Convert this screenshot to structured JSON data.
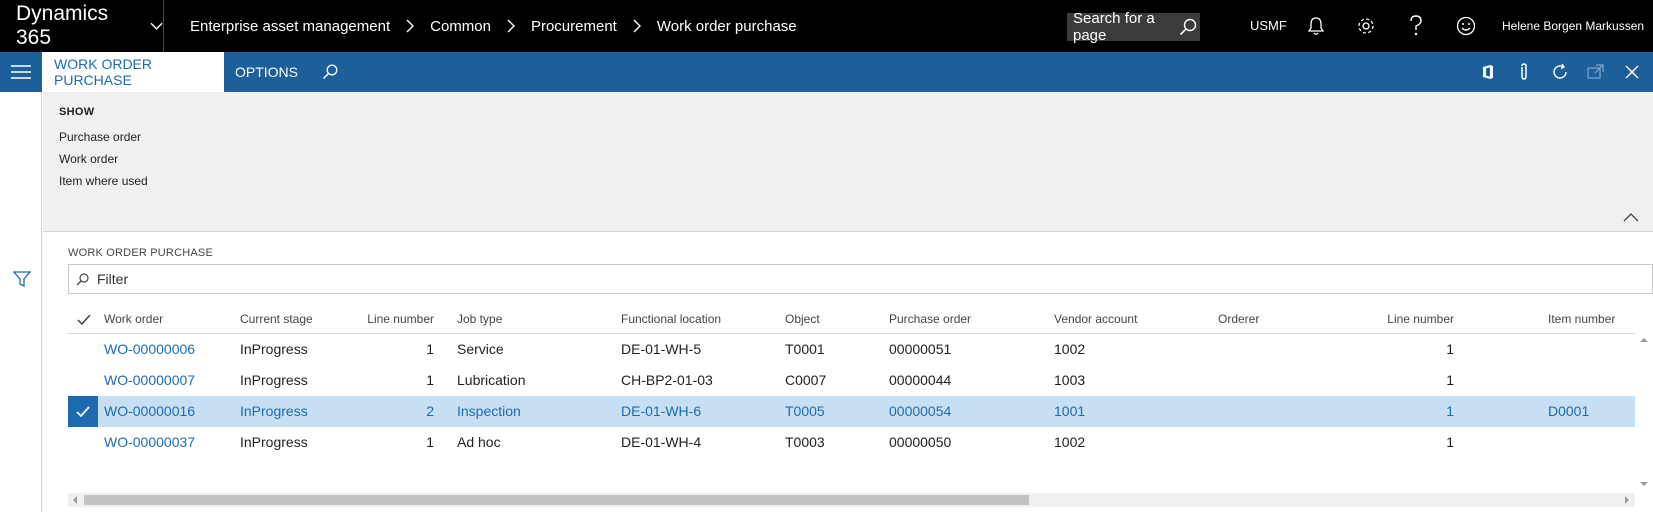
{
  "topbar": {
    "brand": "Dynamics 365",
    "breadcrumbs": [
      "Enterprise asset management",
      "Common",
      "Procurement",
      "Work order purchase"
    ],
    "search_placeholder": "Search for a page",
    "company": "USMF",
    "user": "Helene Borgen Markussen",
    "icons": [
      "chevron-down-icon",
      "search-icon",
      "bell-icon",
      "gear-icon",
      "help-icon",
      "smiley-icon"
    ]
  },
  "actionbar": {
    "active_tab": "WORK ORDER PURCHASE",
    "options_tab": "OPTIONS",
    "right_icons": [
      "office-icon",
      "attachment-icon",
      "refresh-icon",
      "open-new-window-icon",
      "close-icon"
    ]
  },
  "show_pane": {
    "title": "SHOW",
    "items": [
      "Purchase order",
      "Work order",
      "Item where used"
    ]
  },
  "grid": {
    "section_title": "WORK ORDER PURCHASE",
    "filter_placeholder": "Filter",
    "columns": {
      "work_order": "Work order",
      "current_stage": "Current stage",
      "line_number": "Line number",
      "job_type": "Job type",
      "functional_location": "Functional location",
      "object": "Object",
      "purchase_order": "Purchase order",
      "vendor_account": "Vendor account",
      "orderer": "Orderer",
      "line_number_2": "Line number",
      "item_number": "Item number"
    },
    "rows": [
      {
        "work_order": "WO-00000006",
        "current_stage": "InProgress",
        "line_number": "1",
        "job_type": "Service",
        "functional_location": "DE-01-WH-5",
        "object": "T0001",
        "purchase_order": "00000051",
        "vendor_account": "1002",
        "orderer": "",
        "line_number_2": "1",
        "item_number": "",
        "selected": false
      },
      {
        "work_order": "WO-00000007",
        "current_stage": "InProgress",
        "line_number": "1",
        "job_type": "Lubrication",
        "functional_location": "CH-BP2-01-03",
        "object": "C0007",
        "purchase_order": "00000044",
        "vendor_account": "1003",
        "orderer": "",
        "line_number_2": "1",
        "item_number": "",
        "selected": false
      },
      {
        "work_order": "WO-00000016",
        "current_stage": "InProgress",
        "line_number": "2",
        "job_type": "Inspection",
        "functional_location": "DE-01-WH-6",
        "object": "T0005",
        "purchase_order": "00000054",
        "vendor_account": "1001",
        "orderer": "",
        "line_number_2": "1",
        "item_number": "D0001",
        "selected": true
      },
      {
        "work_order": "WO-00000037",
        "current_stage": "InProgress",
        "line_number": "1",
        "job_type": "Ad hoc",
        "functional_location": "DE-01-WH-4",
        "object": "T0003",
        "purchase_order": "00000050",
        "vendor_account": "1002",
        "orderer": "",
        "line_number_2": "1",
        "item_number": "",
        "selected": false
      }
    ],
    "horizontal_scroll_visible_fraction": 0.6
  },
  "colors": {
    "topbar_bg": "#000000",
    "action_bar_bg": "#1d5f99",
    "link": "#1d6ab1",
    "selected_row_bg": "#c7dff2",
    "show_pane_bg": "#f0f0f0"
  }
}
